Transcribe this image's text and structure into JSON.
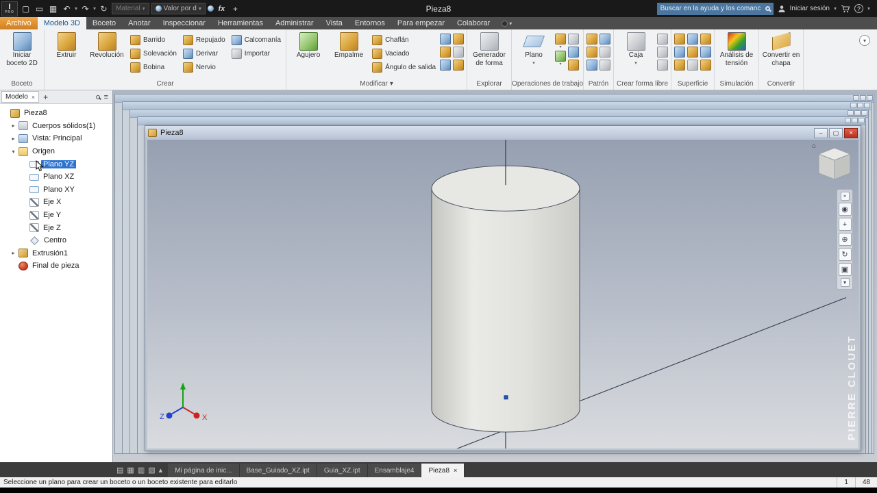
{
  "icons": {
    "caret": "▾",
    "undo": "↶",
    "redo": "↷",
    "update": "↻",
    "expander_open": "▾",
    "expander_closed": "▸",
    "close": "×",
    "minimize": "–",
    "maximize": "▢",
    "plus": "+",
    "menu": "≡",
    "help": "?",
    "home": "⌂",
    "new_doc": "▢",
    "open_doc": "▭",
    "save_doc": "▦",
    "nav_wheel": "◉",
    "nav_pan": "+",
    "nav_zoom": "⊕",
    "nav_orbit": "↻",
    "nav_look": "▣",
    "win_cascade": "▤",
    "win_tile": "▦",
    "win_h": "▥",
    "win_v": "▧",
    "win_up": "▴"
  },
  "titlebar": {
    "title": "Pieza8",
    "material": "Material",
    "appearance": "Valor por d",
    "fx": "fx",
    "search": "Buscar en la ayuda y los comanc",
    "signin": "Iniciar sesión"
  },
  "tabs": [
    "Archivo",
    "Modelo 3D",
    "Boceto",
    "Anotar",
    "Inspeccionar",
    "Herramientas",
    "Administrar",
    "Vista",
    "Entornos",
    "Para empezar",
    "Colaborar"
  ],
  "ribbon": {
    "boceto": {
      "panel": "Boceto",
      "start": "Iniciar boceto 2D"
    },
    "crear": {
      "panel": "Crear",
      "items": [
        "Extruir",
        "Revolución",
        "Barrido",
        "Solevación",
        "Bobina",
        "Repujado",
        "Derivar",
        "Nervio",
        "Calcomanía",
        "Importar"
      ]
    },
    "modificar": {
      "panel": "Modificar",
      "items": [
        "Agujero",
        "Empalme",
        "Chaflán",
        "Vaciado",
        "Ángulo de salida"
      ]
    },
    "explorar": {
      "panel": "Explorar",
      "items": [
        "Generador de forma"
      ]
    },
    "trabajo": {
      "panel": "Operaciones de trabajo",
      "items": [
        "Plano"
      ]
    },
    "patron": {
      "panel": "Patrón"
    },
    "forma": {
      "panel": "Crear forma libre",
      "items": [
        "Caja"
      ]
    },
    "superficie": {
      "panel": "Superficie"
    },
    "simulacion": {
      "panel": "Simulación",
      "items": [
        "Análisis de tensión"
      ]
    },
    "convertir": {
      "panel": "Convertir",
      "items": [
        "Convertir en chapa"
      ]
    }
  },
  "browser": {
    "tab": "Modelo",
    "tree": [
      "Pieza8",
      "Cuerpos sólidos(1)",
      "Vista: Principal",
      "Origen",
      "Plano YZ",
      "Plano XZ",
      "Plano XY",
      "Eje X",
      "Eje Y",
      "Eje Z",
      "Centro",
      "Extrusión1",
      "Final de pieza"
    ]
  },
  "viewport": {
    "window": "Pieza8",
    "watermark": "PIERRE CLOUET",
    "x": "X",
    "z": "Z"
  },
  "doctabs": [
    "Mi página de inic...",
    "Base_Guiado_XZ.ipt",
    "Guia_XZ.ipt",
    "Ensamblaje4",
    "Pieza8"
  ],
  "status": {
    "message": "Seleccione un plano para crear un boceto o un boceto existente para editarlo",
    "n1": "1",
    "n2": "48"
  }
}
